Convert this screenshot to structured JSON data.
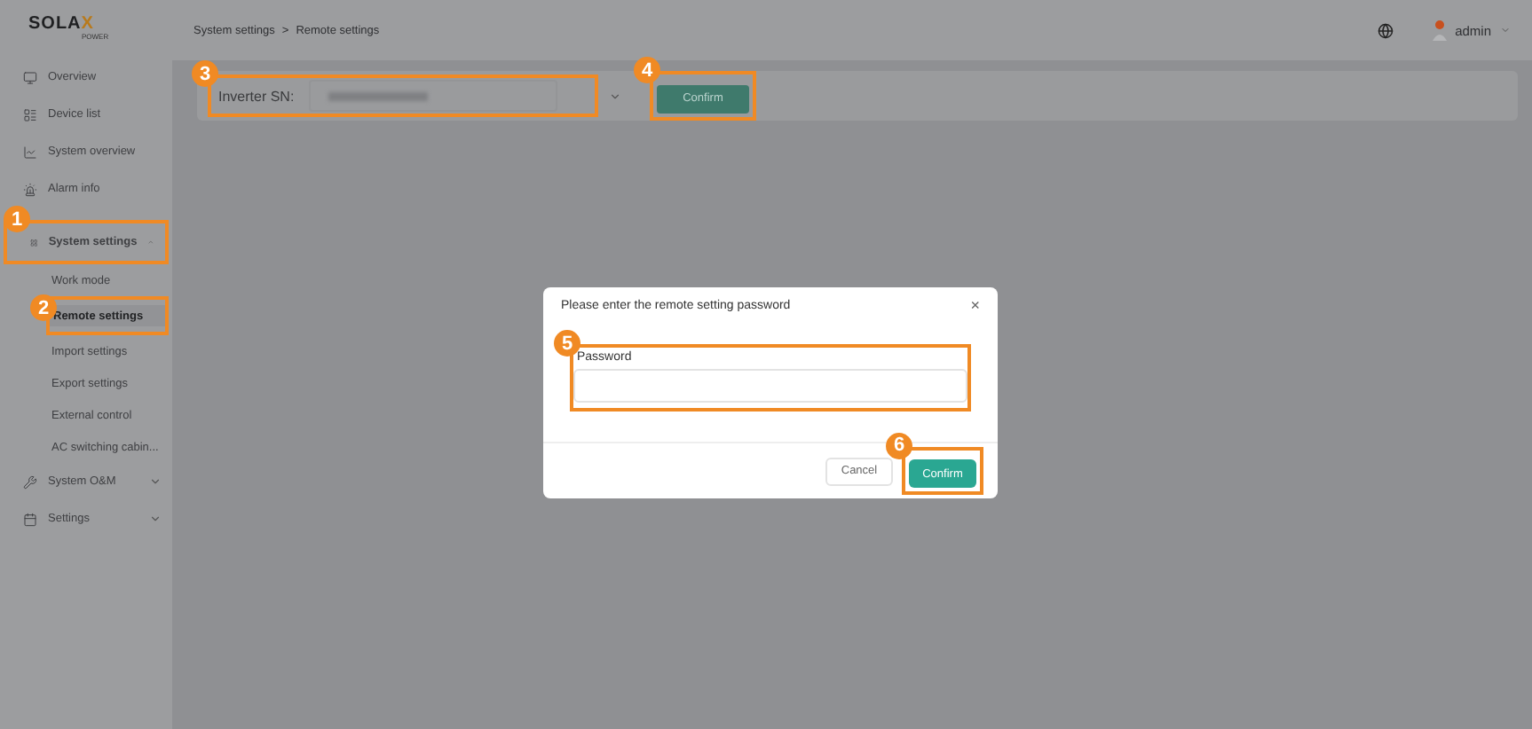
{
  "logo": {
    "word": "SOLAX",
    "sub": "POWER"
  },
  "breadcrumb": {
    "items": [
      "System settings",
      "Remote settings"
    ],
    "separator": ">"
  },
  "header": {
    "user": "admin"
  },
  "sidebar": {
    "items": [
      {
        "kind": "link",
        "label": "Overview",
        "selected": false
      },
      {
        "kind": "link",
        "label": "Device list",
        "selected": false
      },
      {
        "kind": "link",
        "label": "System overview",
        "selected": false
      },
      {
        "kind": "link",
        "label": "Alarm info",
        "selected": false
      },
      {
        "kind": "group",
        "label": "System settings",
        "selected": false,
        "expanded": true,
        "callout": "1",
        "children": [
          {
            "label": "Work mode",
            "selected": false
          },
          {
            "label": "Remote settings",
            "selected": true,
            "callout": "2"
          },
          {
            "label": "Import settings",
            "selected": false
          },
          {
            "label": "Export settings",
            "selected": false
          },
          {
            "label": "External control",
            "selected": false
          },
          {
            "label": "AC switching cabin...",
            "selected": false
          }
        ]
      },
      {
        "kind": "group",
        "label": "System O&M",
        "selected": false,
        "expanded": false
      },
      {
        "kind": "group",
        "label": "Settings",
        "selected": false,
        "expanded": false
      }
    ]
  },
  "filter": {
    "label": "Inverter SN:",
    "callout": "3",
    "button": "Confirm",
    "button_callout": "4"
  },
  "dialog": {
    "title": "Please enter the remote setting password",
    "close": "×",
    "field_label": "Password",
    "field_callout": "5",
    "cancel": "Cancel",
    "confirm": "Confirm",
    "confirm_callout": "6"
  }
}
